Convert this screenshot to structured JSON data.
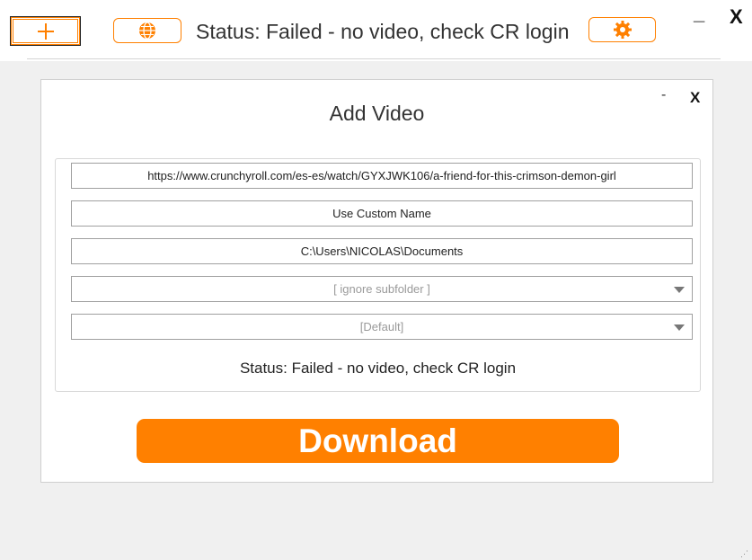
{
  "toolbar": {
    "add_icon": "plus-icon",
    "globe_icon": "globe-icon",
    "settings_icon": "gear-icon",
    "status_text": "Status: Failed - no video, check CR login",
    "minimize_label": "_",
    "close_label": "X"
  },
  "dialog": {
    "title": "Add Video",
    "minimize_label": "-",
    "close_label": "X",
    "url_value": "https://www.crunchyroll.com/es-es/watch/GYXJWK106/a-friend-for-this-crimson-demon-girl",
    "custom_name_value": "Use Custom Name",
    "folder_value": "C:\\Users\\NICOLAS\\Documents",
    "subfolder_selected": "[ ignore subfolder ]",
    "quality_selected": "[Default]",
    "status_text": "Status: Failed - no video, check CR login",
    "download_label": "Download"
  },
  "colors": {
    "accent": "#ff8000",
    "background": "#f0f0f0"
  }
}
